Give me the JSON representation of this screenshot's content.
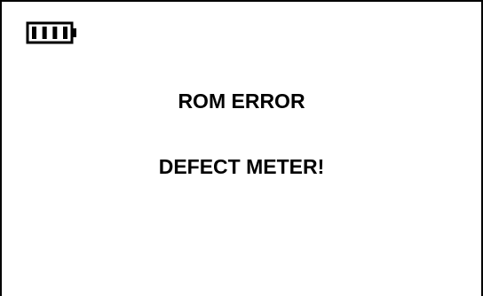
{
  "status_bar": {
    "battery_icon": "battery-full-icon",
    "battery_level": 4,
    "battery_level_max": 4
  },
  "screen": {
    "error_title": "ROM ERROR",
    "error_detail": "DEFECT METER!"
  },
  "colors": {
    "foreground": "#000000",
    "background": "#ffffff"
  }
}
